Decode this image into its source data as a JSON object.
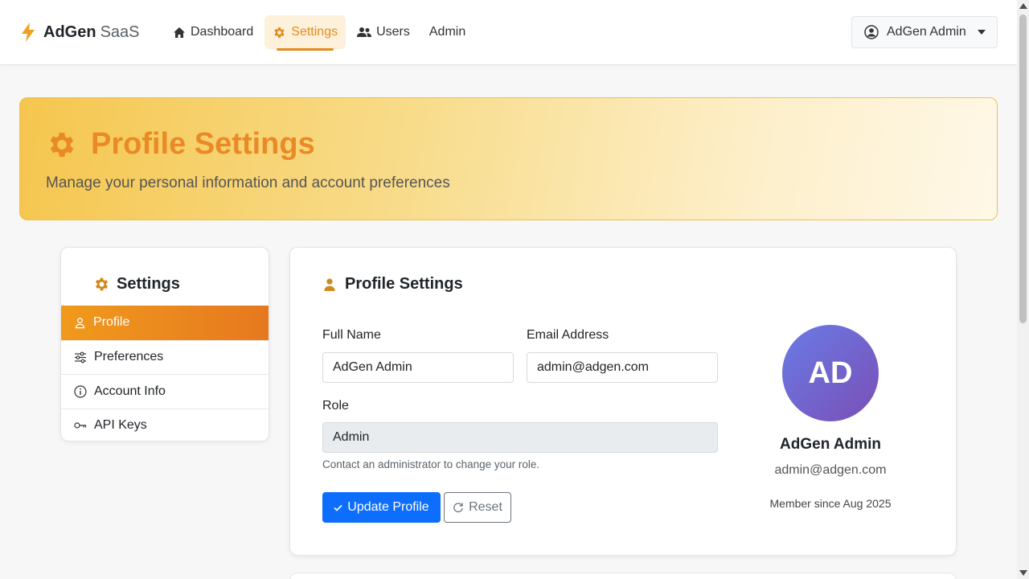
{
  "brand": {
    "name_bold": "AdGen",
    "name_light": "SaaS"
  },
  "nav": {
    "dashboard": "Dashboard",
    "settings": "Settings",
    "users": "Users",
    "admin": "Admin"
  },
  "user_menu": {
    "label": "AdGen Admin"
  },
  "hero": {
    "title": "Profile Settings",
    "subtitle": "Manage your personal information and account preferences"
  },
  "sidebar": {
    "title": "Settings",
    "items": [
      {
        "label": "Profile",
        "icon": "person-icon",
        "active": true
      },
      {
        "label": "Preferences",
        "icon": "sliders-icon"
      },
      {
        "label": "Account Info",
        "icon": "info-icon"
      },
      {
        "label": "API Keys",
        "icon": "key-icon"
      }
    ]
  },
  "profile_form": {
    "title": "Profile Settings",
    "full_name_label": "Full Name",
    "full_name_value": "AdGen Admin",
    "email_label": "Email Address",
    "email_value": "admin@adgen.com",
    "role_label": "Role",
    "role_value": "Admin",
    "role_help": "Contact an administrator to change your role.",
    "update_button": "Update Profile",
    "reset_button": "Reset"
  },
  "profile_card": {
    "initials": "AD",
    "name": "AdGen Admin",
    "email": "admin@adgen.com",
    "member_since": "Member since Aug 2025"
  },
  "colors": {
    "accent": "#e58a1a",
    "primary": "#0d6efd",
    "avatar_start": "#6a7be6",
    "avatar_end": "#7a4fb6"
  }
}
